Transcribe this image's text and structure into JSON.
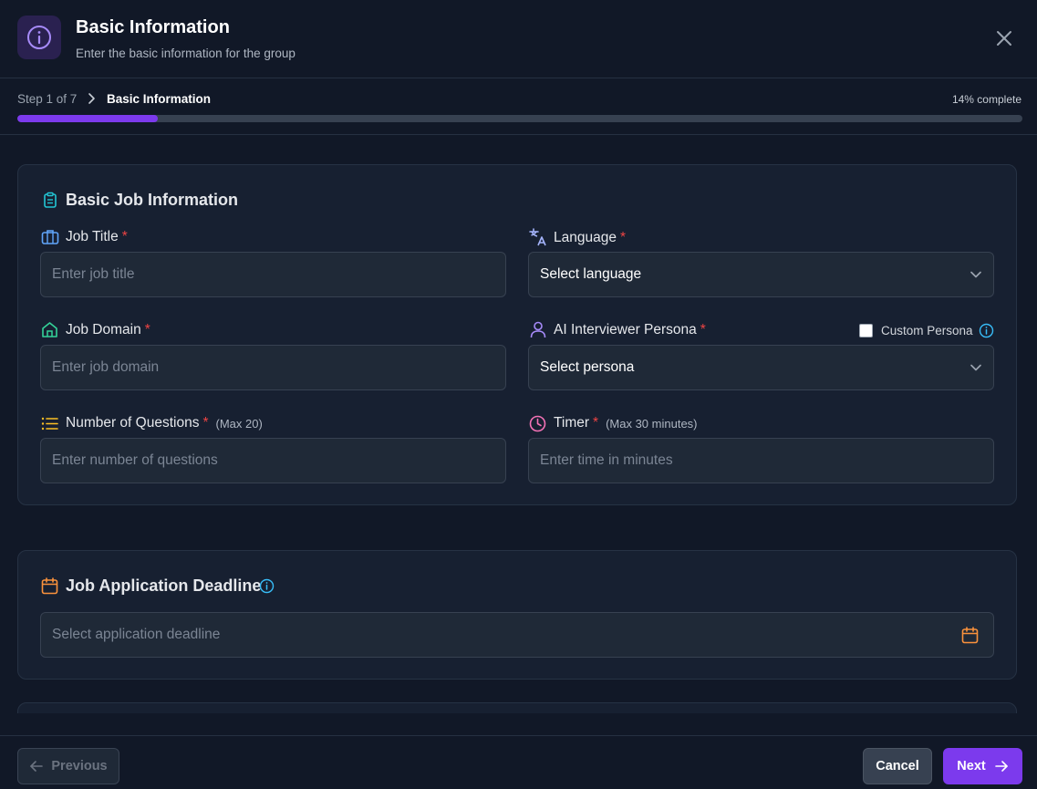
{
  "header": {
    "title": "Basic Information",
    "subtitle": "Enter the basic information for the group",
    "icon": "info-icon",
    "accent": "#7c3aed"
  },
  "progress": {
    "step_text": "Step 1 of 7",
    "current_step": "Basic Information",
    "percent_text": "14% complete",
    "percent": 14
  },
  "basic_job": {
    "title": "Basic Job Information",
    "fields": {
      "job_title": {
        "label": "Job Title",
        "placeholder": "Enter job title"
      },
      "language": {
        "label": "Language",
        "value": "Select language"
      },
      "job_domain": {
        "label": "Job Domain",
        "placeholder": "Enter job domain"
      },
      "persona": {
        "label": "AI Interviewer Persona",
        "value": "Select persona",
        "custom_label": "Custom Persona"
      },
      "num_questions": {
        "label": "Number of Questions",
        "hint": "(Max 20)",
        "placeholder": "Enter number of questions"
      },
      "timer": {
        "label": "Timer",
        "hint": "(Max 30 minutes)",
        "placeholder": "Enter time in minutes"
      }
    },
    "required_mark": "*"
  },
  "deadline": {
    "title": "Job Application Deadline",
    "placeholder": "Select application deadline"
  },
  "footer": {
    "previous_label": "Previous",
    "cancel_label": "Cancel",
    "next_label": "Next"
  },
  "colors": {
    "background": "#111827",
    "card": "#172031",
    "accent": "#7c3aed",
    "required": "#ef4444"
  }
}
